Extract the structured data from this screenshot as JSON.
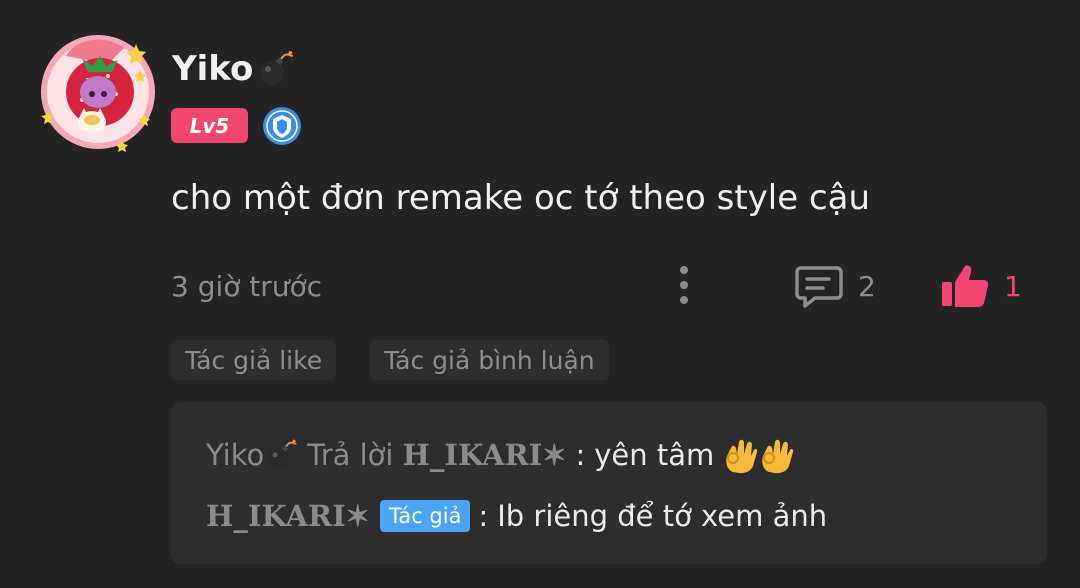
{
  "post": {
    "username": "Yiko",
    "username_icon": "bomb-icon",
    "level": "Lv5",
    "verified_icon": "blue-shield-badge-icon",
    "comment": "cho một đơn remake oc tớ theo style cậu",
    "timestamp": "3 giờ trước",
    "reply_count": "2",
    "like_count": "1",
    "tags": [
      "Tác giả like",
      "Tác giả bình luận"
    ]
  },
  "replies": [
    {
      "from": "Yiko",
      "action": "Trả lời",
      "to": "H_IKARI✶",
      "separator": ":",
      "text": "yên tâm",
      "emoji": "ok-hand-icon"
    },
    {
      "from": "H_IKARI✶",
      "badge": "Tác giả",
      "separator": ":",
      "text": "Ib riêng để tớ xem ảnh"
    }
  ],
  "colors": {
    "background": "#232323",
    "panel": "#2d2d2d",
    "primary_text": "#f0f0f0",
    "secondary_text": "#8d8d8d",
    "accent_pink": "#f0466f",
    "author_badge_blue": "#4ba3f2"
  }
}
